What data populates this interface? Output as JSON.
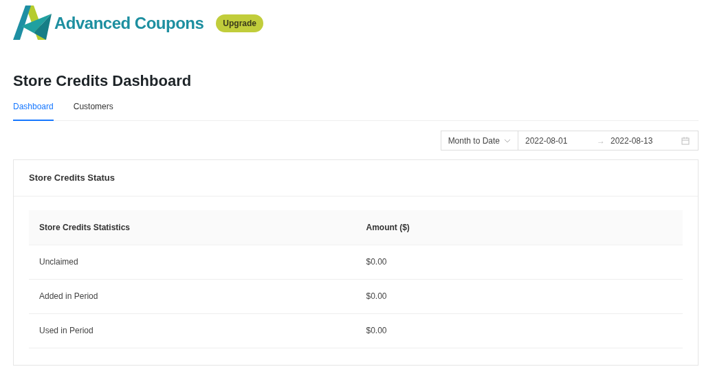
{
  "brand": {
    "name": "Advanced Coupons",
    "badge": "Upgrade"
  },
  "page_title": "Store Credits Dashboard",
  "tabs": [
    {
      "label": "Dashboard",
      "selected": true
    },
    {
      "label": "Customers",
      "selected": false
    }
  ],
  "period": {
    "preset": "Month to Date",
    "start": "2022-08-01",
    "separator": "→",
    "end": "2022-08-13"
  },
  "card": {
    "title": "Store Credits Status",
    "table": {
      "columns": [
        "Store Credits Statistics",
        "Amount ($)"
      ],
      "rows": [
        [
          "Unclaimed",
          "$0.00"
        ],
        [
          "Added in Period",
          "$0.00"
        ],
        [
          "Used in Period",
          "$0.00"
        ]
      ]
    }
  }
}
